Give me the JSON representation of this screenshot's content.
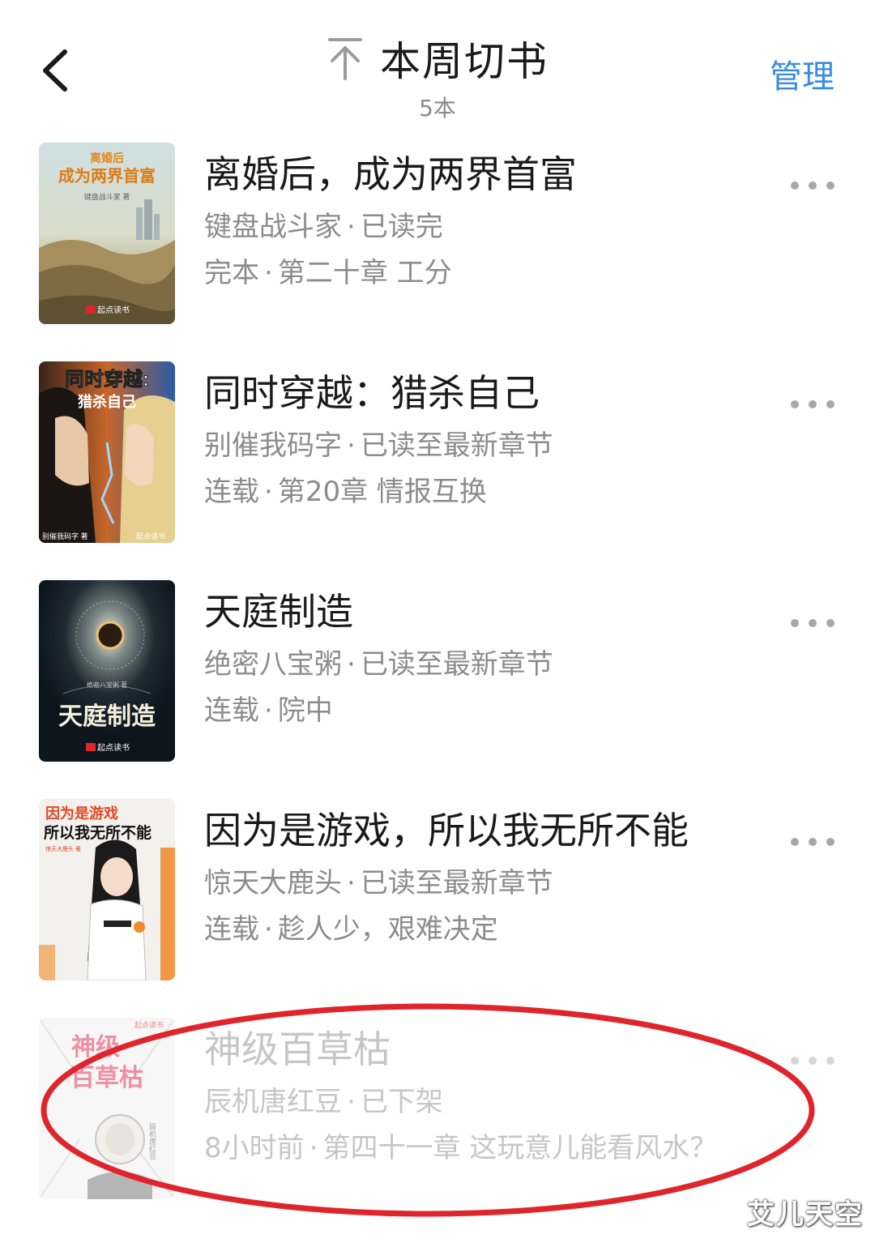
{
  "header": {
    "title": "本周切书",
    "count": "5本",
    "manage_label": "管理"
  },
  "books": [
    {
      "title": "离婚后，成为两界首富",
      "author": "键盘战斗家",
      "read_status": "已读完",
      "serial_status": "完本",
      "chapter": "第二十章 工分",
      "cover_title_top": "离婚后",
      "cover_title_main": "成为两界首富",
      "cover_author": "键盘战斗家 著",
      "cover_brand": "起点读书"
    },
    {
      "title": "同时穿越：猎杀自己",
      "author": "别催我码字",
      "read_status": "已读至最新章节",
      "serial_status": "连载",
      "chapter": "第20章 情报互换",
      "cover_title_top": "同时穿越:",
      "cover_title_main": "猎杀自己",
      "cover_author": "别催我码字 著",
      "cover_brand": "起点读书"
    },
    {
      "title": "天庭制造",
      "author": "绝密八宝粥",
      "read_status": "已读至最新章节",
      "serial_status": "连载",
      "chapter": "院中",
      "cover_title_top": "绝密八宝粥 著",
      "cover_title_main": "天庭制造",
      "cover_brand": "起点读书"
    },
    {
      "title": "因为是游戏，所以我无所不能",
      "author": "惊天大鹿头",
      "read_status": "已读至最新章节",
      "serial_status": "连载",
      "chapter": "趁人少，艰难决定",
      "cover_title_top": "因为是游戏",
      "cover_title_main": "所以我无所不能",
      "cover_author": "惊天大鹿头 著"
    },
    {
      "title": "神级百草枯",
      "author": "辰机唐红豆",
      "read_status": "已下架",
      "serial_status": "8小时前",
      "chapter": "第四十一章 这玩意儿能看风水？",
      "cover_title_top": "神级",
      "cover_title_main": "百草枯",
      "cover_author": "辰机唐红豆",
      "cover_brand": "起点读书"
    }
  ],
  "separator": "·",
  "watermark": "艾儿天空",
  "colors": {
    "accent": "#3a8be0",
    "title": "#1a1a1a",
    "meta": "#8c8c8c",
    "removed": "#c6c6c6",
    "annotation": "#e0242b"
  },
  "icons": {
    "back": "chevron-left-icon",
    "pin": "pin-top-icon",
    "more": "more-dots-icon"
  }
}
